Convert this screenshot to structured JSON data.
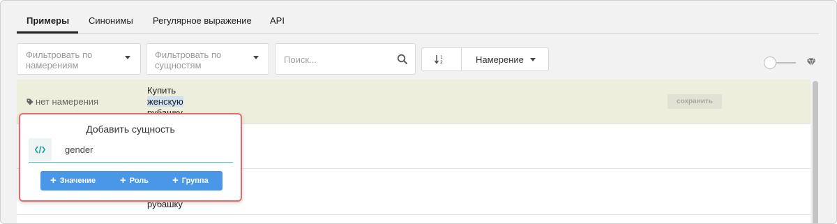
{
  "tabs": [
    {
      "label": "Примеры",
      "active": true
    },
    {
      "label": "Синонимы",
      "active": false
    },
    {
      "label": "Регулярное выражение",
      "active": false
    },
    {
      "label": "API",
      "active": false
    }
  ],
  "filters": {
    "by_intent_line1": "Фильтровать по",
    "by_intent_line2": "намерениям",
    "by_entity_line1": "Фильтровать по",
    "by_entity_line2": "сущностям"
  },
  "search": {
    "placeholder": "Поиск..."
  },
  "sort": {
    "dropdown_label": "Намерение"
  },
  "examples": [
    {
      "intent": "нет намерения",
      "lines": [
        "Купить",
        "женскую",
        "рубашку"
      ],
      "save_label": "сохранить"
    },
    {
      "lines": [
        "рубашку"
      ]
    }
  ],
  "popup": {
    "title": "Добавить сущность",
    "entity": "gender",
    "buttons": [
      "Значение",
      "Роль",
      "Группа"
    ]
  },
  "colors": {
    "accent": "#4a97e8",
    "popup_border": "#e36b6b",
    "highlight_row": "#eeeedd",
    "entity_teal": "#1fa59b"
  }
}
